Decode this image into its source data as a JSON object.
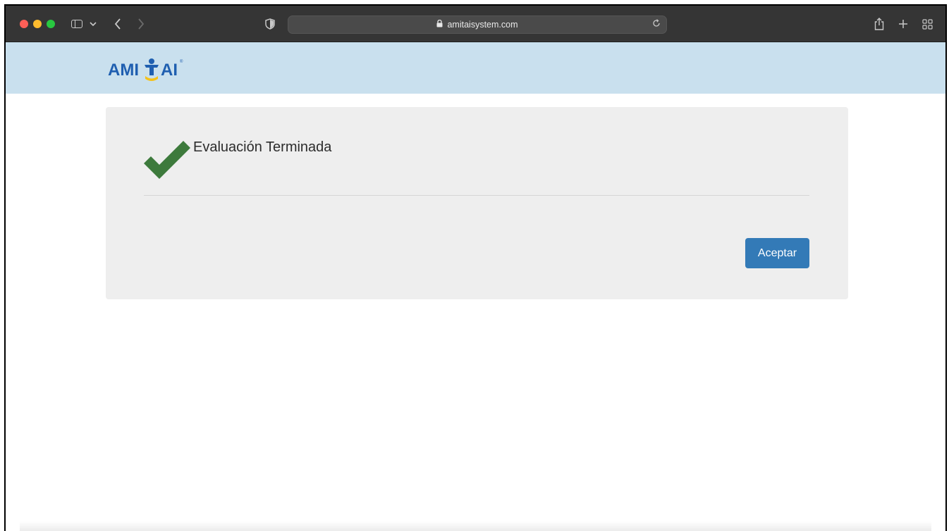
{
  "browser": {
    "url": "amitaisystem.com",
    "icons": {
      "sidebar": "sidebar-icon",
      "back": "chevron-left-icon",
      "forward": "chevron-right-icon",
      "privacy": "shield-icon",
      "lock": "lock-icon",
      "reload": "reload-icon",
      "share": "share-icon",
      "new_tab": "plus-icon",
      "tab_overview": "tab-grid-icon"
    }
  },
  "site": {
    "logo_text": "AMITAI"
  },
  "dialog": {
    "title": "Evaluación Terminada",
    "accept_label": "Aceptar"
  },
  "colors": {
    "header_bg": "#c9e0ee",
    "card_bg": "#eeeeee",
    "check_green": "#3d7a3c",
    "button_blue": "#337ab7",
    "logo_blue": "#1f5fb0",
    "logo_yellow": "#f4c21a"
  }
}
